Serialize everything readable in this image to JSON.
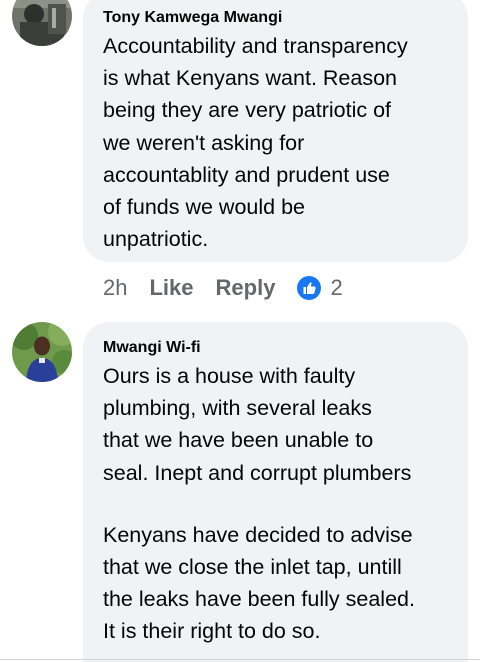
{
  "comments": [
    {
      "author": "Tony Kamwega Mwangi",
      "text": "Accountability and transparency is what Kenyans want. Reason being they are very patriotic of we weren't asking for accountablity and prudent use of funds we would be unpatriotic.",
      "lines": [
        "Accountability and transparency",
        "is what Kenyans want. Reason",
        "being they are very patriotic of",
        "we weren't asking for",
        "accountablity and prudent use",
        "of funds we would be",
        "unpatriotic."
      ],
      "time": "2h",
      "like_label": "Like",
      "reply_label": "Reply",
      "reaction_icon": "thumbs-up-icon",
      "reaction_count": "2"
    },
    {
      "author": "Mwangi Wi-fi",
      "paragraphs": [
        [
          "Ours is a house with faulty",
          "plumbing, with several leaks",
          "that we have been unable to",
          "seal. Inept and corrupt plumbers"
        ],
        [
          "Kenyans have decided to advise",
          "that we close the inlet tap, untill",
          "the leaks have been fully sealed.",
          "It is their right to do so."
        ]
      ]
    }
  ],
  "colors": {
    "bubble_bg": "#f0f2f5",
    "action_text": "#65676b",
    "like_blue": "#1877f2"
  }
}
